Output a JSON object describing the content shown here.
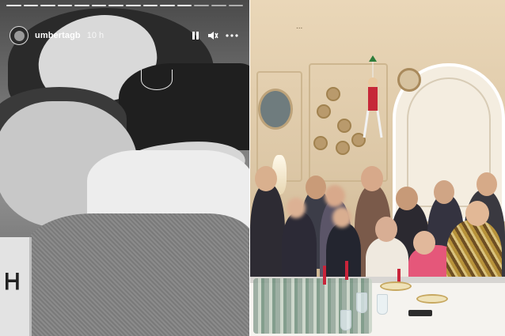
{
  "story": {
    "username": "umbertagb",
    "timestamp": "10 h",
    "icons": [
      "pause-icon",
      "mute-icon",
      "more-options-icon"
    ],
    "progress_segments": 14
  },
  "dinner_photo": {
    "ceiling_mark": "...",
    "wall_color": "#dcc7a6",
    "tablecloth_color": "#f5f3ef"
  }
}
